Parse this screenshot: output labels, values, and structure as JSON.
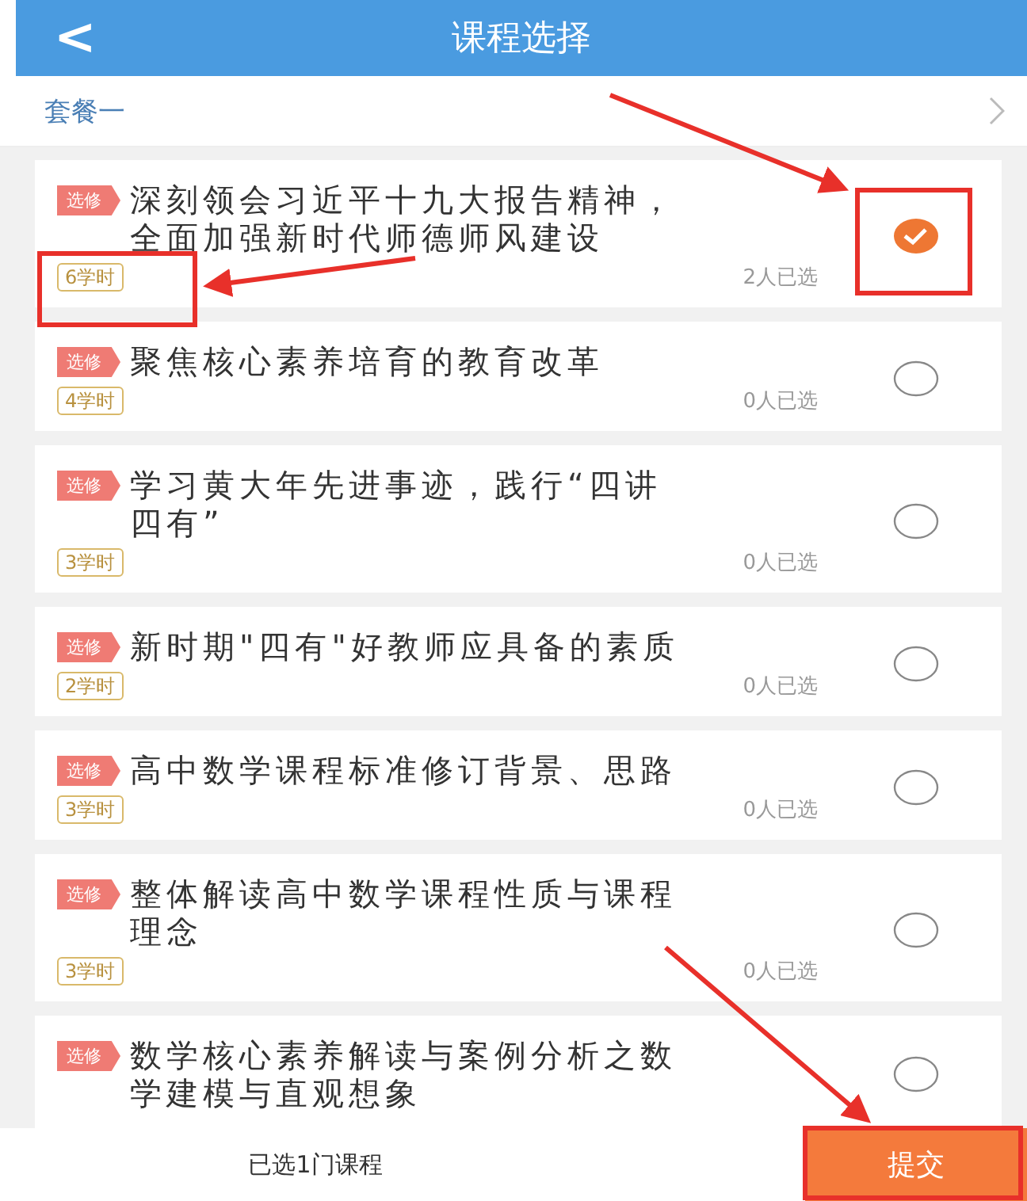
{
  "header": {
    "back_icon": "<",
    "title": "课程选择"
  },
  "package": {
    "label": "套餐一"
  },
  "courses": [
    {
      "tag": "选修",
      "title": "深刻领会习近平十九大报告精神，全面加强新时代师德师风建设",
      "hours": "6学时",
      "count": "2人已选",
      "selected": true
    },
    {
      "tag": "选修",
      "title": "聚焦核心素养培育的教育改革",
      "hours": "4学时",
      "count": "0人已选",
      "selected": false
    },
    {
      "tag": "选修",
      "title": "学习黄大年先进事迹，践行“四讲四有”",
      "hours": "3学时",
      "count": "0人已选",
      "selected": false
    },
    {
      "tag": "选修",
      "title": "新时期\"四有\"好教师应具备的素质",
      "hours": "2学时",
      "count": "0人已选",
      "selected": false
    },
    {
      "tag": "选修",
      "title": "高中数学课程标准修订背景、思路",
      "hours": "3学时",
      "count": "0人已选",
      "selected": false
    },
    {
      "tag": "选修",
      "title": "整体解读高中数学课程性质与课程理念",
      "hours": "3学时",
      "count": "0人已选",
      "selected": false
    },
    {
      "tag": "选修",
      "title": "数学核心素养解读与案例分析之数学建模与直观想象",
      "selected": false
    }
  ],
  "footer": {
    "summary": "已选1门课程",
    "submit": "提交"
  }
}
